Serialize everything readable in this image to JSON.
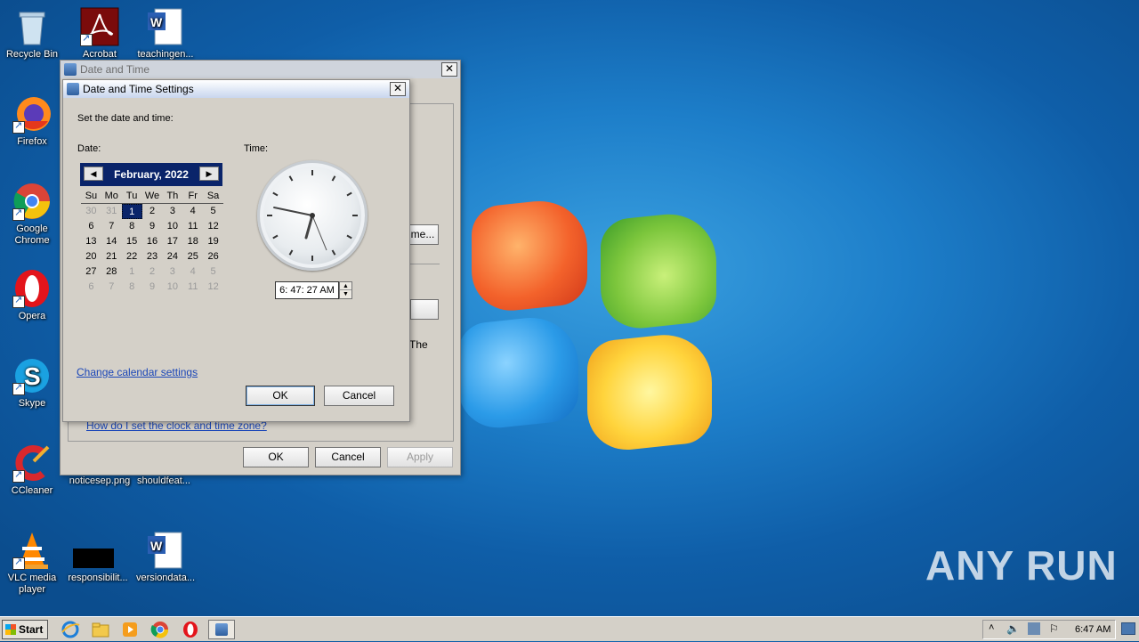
{
  "desktop": {
    "icons": [
      {
        "label": "Recycle Bin"
      },
      {
        "label": "Acrobat"
      },
      {
        "label": "teachingen..."
      },
      {
        "label": "Firefox"
      },
      {
        "label": "Google Chrome"
      },
      {
        "label": "Opera"
      },
      {
        "label": "Skype"
      },
      {
        "label": "CCleaner"
      },
      {
        "label": "noticesep.png"
      },
      {
        "label": "shouldfeat..."
      },
      {
        "label": "VLC media player"
      },
      {
        "label": "responsibilit..."
      },
      {
        "label": "versiondata..."
      }
    ],
    "watermark": "ANY RUN"
  },
  "outer_dialog": {
    "title": "Date and Time",
    "partial_button": "me...",
    "partial_text": "The",
    "help_link": "How do I set the clock and time zone?",
    "ok": "OK",
    "cancel": "Cancel",
    "apply": "Apply"
  },
  "settings_dialog": {
    "title": "Date and Time Settings",
    "instruction": "Set the date and time:",
    "date_label": "Date:",
    "time_label": "Time:",
    "calendar": {
      "month": "February, 2022",
      "weekdays": [
        "Su",
        "Mo",
        "Tu",
        "We",
        "Th",
        "Fr",
        "Sa"
      ],
      "weeks": [
        [
          "30",
          "31",
          "1",
          "2",
          "3",
          "4",
          "5"
        ],
        [
          "6",
          "7",
          "8",
          "9",
          "10",
          "11",
          "12"
        ],
        [
          "13",
          "14",
          "15",
          "16",
          "17",
          "18",
          "19"
        ],
        [
          "20",
          "21",
          "22",
          "23",
          "24",
          "25",
          "26"
        ],
        [
          "27",
          "28",
          "1",
          "2",
          "3",
          "4",
          "5"
        ],
        [
          "6",
          "7",
          "8",
          "9",
          "10",
          "11",
          "12"
        ]
      ],
      "selected": "1"
    },
    "time_value": "6: 47: 27 AM",
    "change_calendar_link": "Change calendar settings",
    "ok": "OK",
    "cancel": "Cancel"
  },
  "taskbar": {
    "start": "Start",
    "clock": "6:47 AM"
  }
}
